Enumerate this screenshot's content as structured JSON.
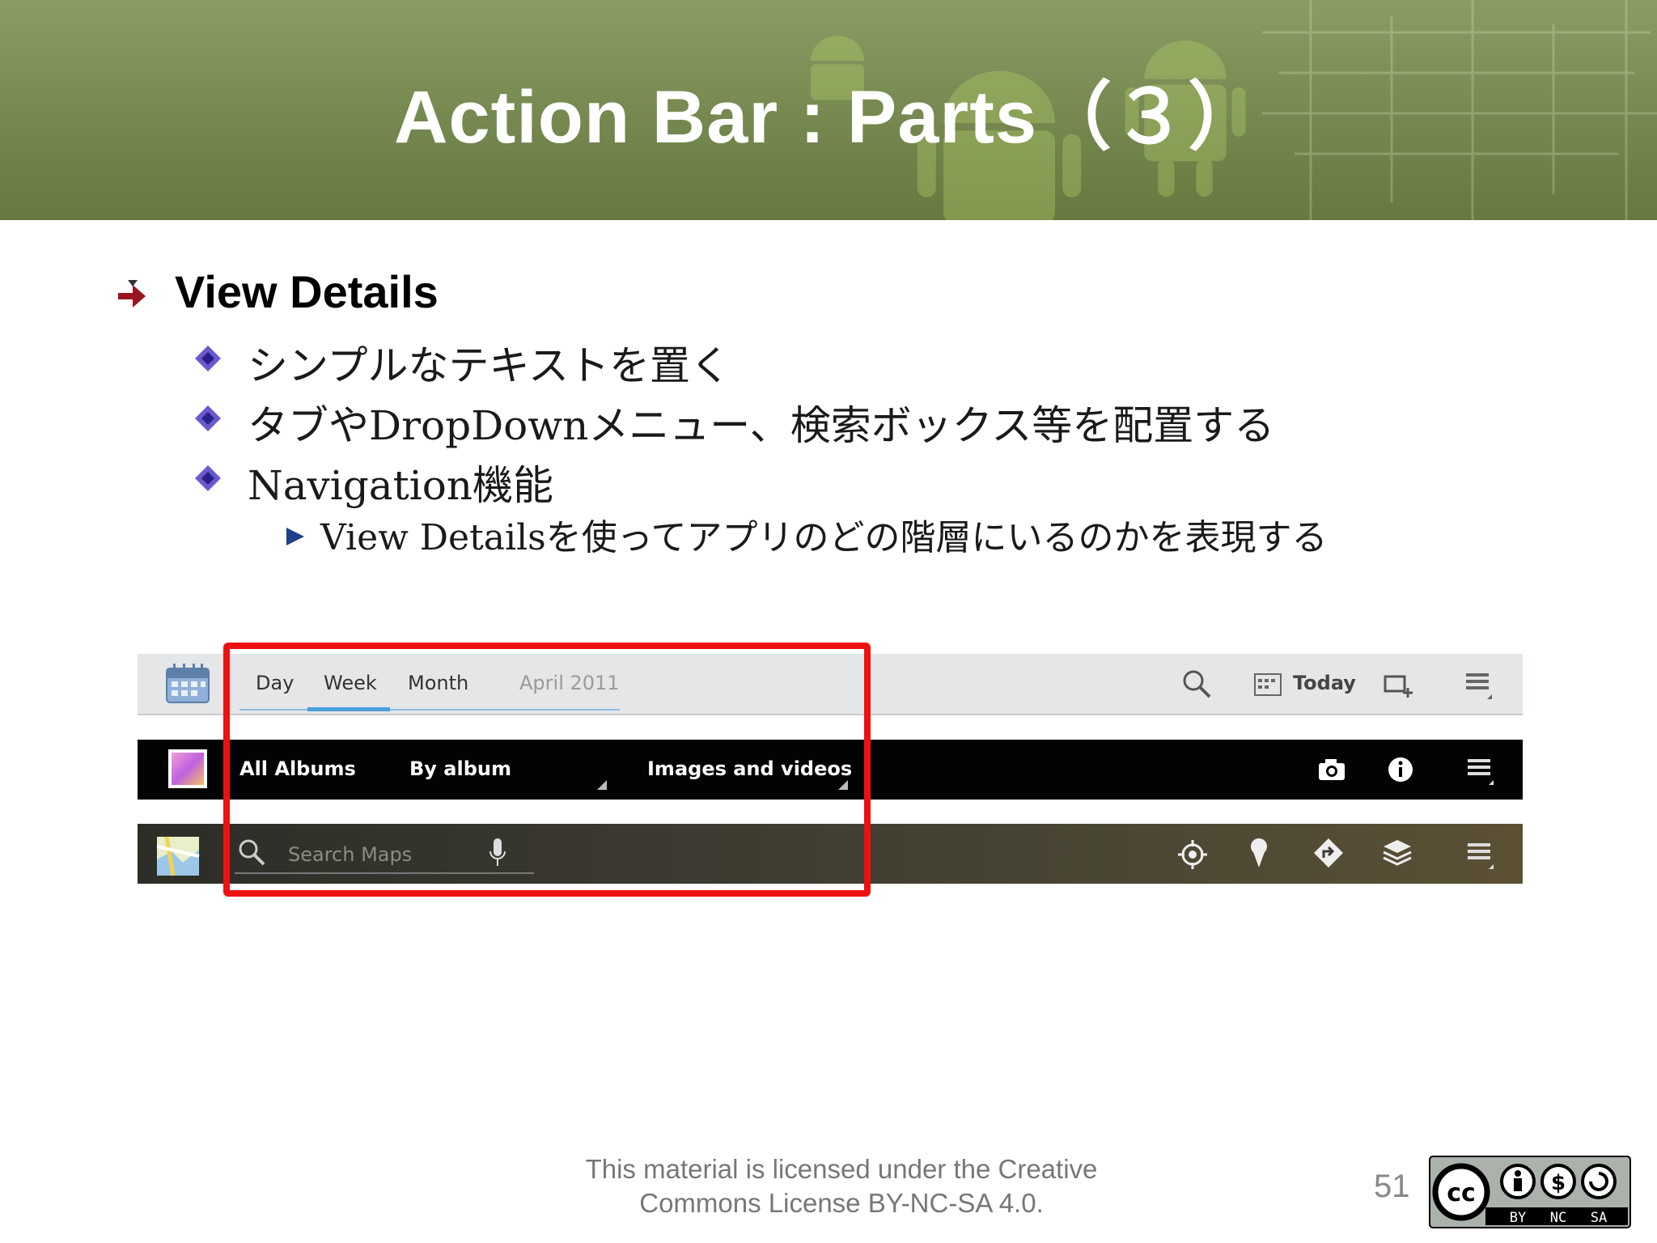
{
  "slide": {
    "title": "Action Bar : Parts（３）",
    "page_number": "51",
    "footer_line1": "This material is licensed under the Creative",
    "footer_line2": "Commons License BY-NC-SA 4.0."
  },
  "bullets": {
    "heading": "View Details",
    "items": [
      "シンプルなテキストを置く",
      "タブやDropDownメニュー、検索ボックス等を配置する",
      "Navigation機能"
    ],
    "sub_item": "View Detailsを使ってアプリのどの階層にいるのかを表現する"
  },
  "calendar_bar": {
    "tabs": [
      "Day",
      "Week",
      "Month"
    ],
    "date": "April 2011",
    "today_label": "Today"
  },
  "gallery_bar": {
    "all_albums": "All Albums",
    "by_album": "By album",
    "images_videos": "Images and videos"
  },
  "maps_bar": {
    "search_placeholder": "Search Maps"
  },
  "license_badge": {
    "cc": "cc",
    "by": "BY",
    "nc": "NC",
    "sa": "SA"
  },
  "colors": {
    "header": "#74884f",
    "highlight_box": "#ee1111",
    "tab_underline": "#4a9ede"
  }
}
